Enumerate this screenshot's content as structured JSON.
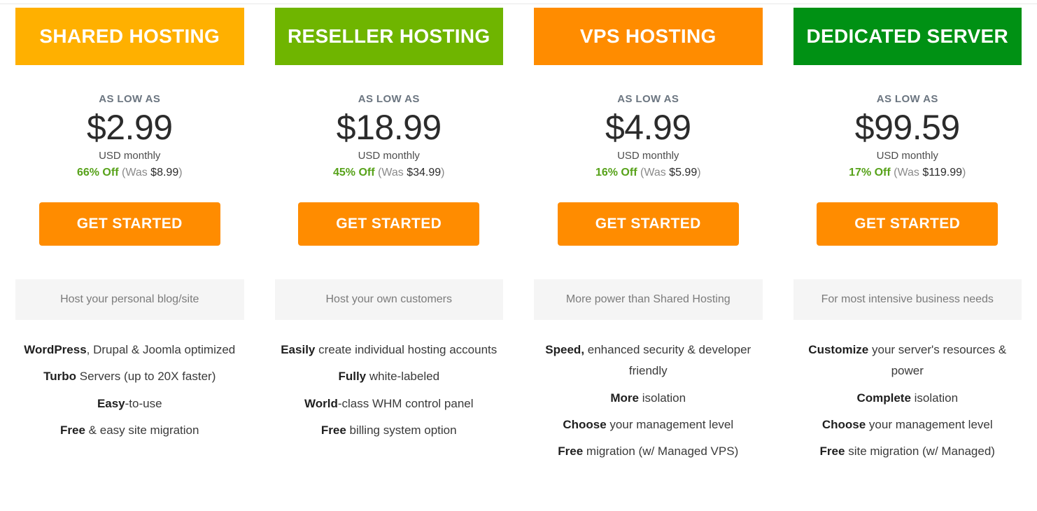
{
  "common": {
    "as_low_as_label": "AS LOW AS",
    "period_label": "USD monthly",
    "was_prefix": "(Was ",
    "was_suffix": ")",
    "cta_label": "GET STARTED"
  },
  "colors": {
    "shared_header": "#ffb000",
    "reseller_header": "#6fb500",
    "vps_header": "#ff8c00",
    "dedicated_header": "#009114",
    "cta": "#ff8c00",
    "discount_green": "#57a21a",
    "tagline_band": "#f5f5f5"
  },
  "plans": [
    {
      "name": "SHARED HOSTING",
      "header_color": "#ffb000",
      "as_low_as": "AS LOW AS",
      "price": "$2.99",
      "period": "USD monthly",
      "discount": "66% Off",
      "was_prefix": "(Was ",
      "was_price": "$8.99",
      "was_suffix": ")",
      "cta": "GET STARTED",
      "tagline": "Host your personal blog/site",
      "features": [
        {
          "bold": "WordPress",
          "rest": ", Drupal & Joomla optimized"
        },
        {
          "bold": "Turbo",
          "rest": " Servers (up to 20X faster)"
        },
        {
          "bold": "Easy",
          "rest": "-to-use"
        },
        {
          "bold": "Free",
          "rest": " & easy site migration"
        }
      ]
    },
    {
      "name": "RESELLER HOSTING",
      "header_color": "#6fb500",
      "as_low_as": "AS LOW AS",
      "price": "$18.99",
      "period": "USD monthly",
      "discount": "45% Off",
      "was_prefix": "(Was ",
      "was_price": "$34.99",
      "was_suffix": ")",
      "cta": "GET STARTED",
      "tagline": "Host your own customers",
      "features": [
        {
          "bold": "Easily",
          "rest": " create individual hosting accounts"
        },
        {
          "bold": "Fully",
          "rest": " white-labeled"
        },
        {
          "bold": "World",
          "rest": "-class WHM control panel"
        },
        {
          "bold": "Free",
          "rest": " billing system option"
        }
      ]
    },
    {
      "name": "VPS HOSTING",
      "header_color": "#ff8c00",
      "as_low_as": "AS LOW AS",
      "price": "$4.99",
      "period": "USD monthly",
      "discount": "16% Off",
      "was_prefix": "(Was ",
      "was_price": "$5.99",
      "was_suffix": ")",
      "cta": "GET STARTED",
      "tagline": "More power than Shared Hosting",
      "features": [
        {
          "bold": "Speed,",
          "rest": " enhanced security & developer friendly"
        },
        {
          "bold": "More",
          "rest": " isolation"
        },
        {
          "bold": "Choose",
          "rest": " your management level"
        },
        {
          "bold": "Free",
          "rest": " migration (w/ Managed VPS)"
        }
      ]
    },
    {
      "name": "DEDICATED SERVER",
      "header_color": "#009114",
      "as_low_as": "AS LOW AS",
      "price": "$99.59",
      "period": "USD monthly",
      "discount": "17% Off",
      "was_prefix": "(Was ",
      "was_price": "$119.99",
      "was_suffix": ")",
      "cta": "GET STARTED",
      "tagline": "For most intensive business needs",
      "features": [
        {
          "bold": "Customize",
          "rest": " your server's resources & power"
        },
        {
          "bold": "Complete",
          "rest": " isolation"
        },
        {
          "bold": "Choose",
          "rest": " your management level"
        },
        {
          "bold": "Free",
          "rest": " site migration (w/ Managed)"
        }
      ]
    }
  ]
}
